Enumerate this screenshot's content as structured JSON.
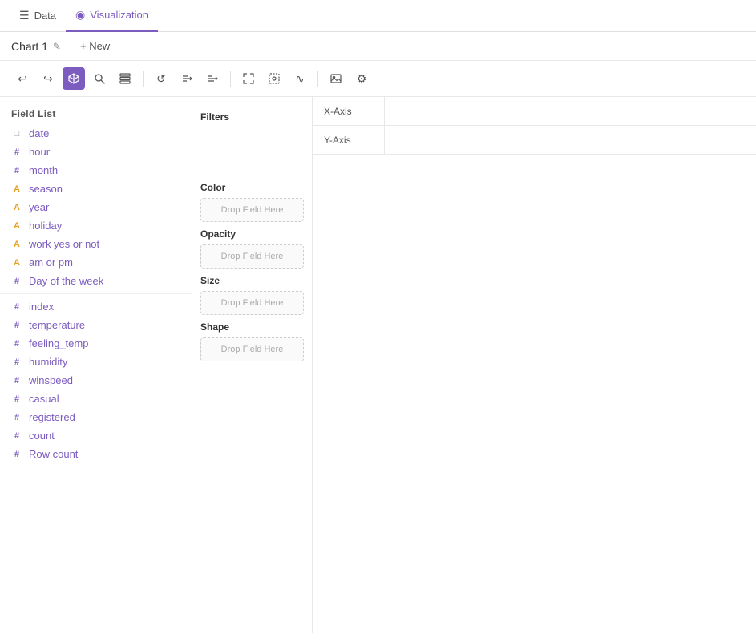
{
  "tabs": [
    {
      "id": "data",
      "label": "Data",
      "icon": "☰",
      "active": false
    },
    {
      "id": "visualization",
      "label": "Visualization",
      "icon": "◉",
      "active": true
    }
  ],
  "chart_title": "Chart 1",
  "new_button_label": "+ New",
  "toolbar": {
    "buttons": [
      {
        "id": "undo",
        "icon": "↩",
        "label": "undo",
        "active": false
      },
      {
        "id": "redo",
        "icon": "↪",
        "label": "redo",
        "active": false
      },
      {
        "id": "cube",
        "icon": "⬡",
        "label": "cube-view",
        "active": true
      },
      {
        "id": "search",
        "icon": "○",
        "label": "search",
        "active": false
      },
      {
        "id": "layers",
        "icon": "⧉",
        "label": "layers",
        "active": false
      },
      {
        "divider": true
      },
      {
        "id": "refresh",
        "icon": "↺",
        "label": "refresh",
        "active": false
      },
      {
        "id": "filter1",
        "icon": "⇅",
        "label": "filter-asc",
        "active": false
      },
      {
        "id": "filter2",
        "icon": "⇵",
        "label": "filter-desc",
        "active": false
      },
      {
        "divider": true
      },
      {
        "id": "move",
        "icon": "⤢",
        "label": "move",
        "active": false
      },
      {
        "id": "select",
        "icon": "⊡",
        "label": "select",
        "active": false
      },
      {
        "id": "connect",
        "icon": "∿",
        "label": "connect",
        "active": false
      },
      {
        "divider": true
      },
      {
        "id": "image",
        "icon": "⬜",
        "label": "image",
        "active": false
      },
      {
        "id": "settings",
        "icon": "◫",
        "label": "settings",
        "active": false
      }
    ]
  },
  "field_list": {
    "title": "Field List",
    "fields": [
      {
        "id": "date",
        "label": "date",
        "type": "date",
        "icon": "□"
      },
      {
        "id": "hour",
        "label": "hour",
        "type": "numeric",
        "icon": "#"
      },
      {
        "id": "month",
        "label": "month",
        "type": "numeric",
        "icon": "#"
      },
      {
        "id": "season",
        "label": "season",
        "type": "text",
        "icon": "A"
      },
      {
        "id": "year",
        "label": "year",
        "type": "text",
        "icon": "A"
      },
      {
        "id": "holiday",
        "label": "holiday",
        "type": "text",
        "icon": "A"
      },
      {
        "id": "work_yes_or_not",
        "label": "work yes or not",
        "type": "text",
        "icon": "A"
      },
      {
        "id": "am_or_pm",
        "label": "am or pm",
        "type": "text",
        "icon": "A"
      },
      {
        "id": "day_of_week",
        "label": "Day of the week",
        "type": "numeric",
        "icon": "#"
      },
      {
        "id": "index",
        "label": "index",
        "type": "numeric",
        "icon": "#"
      },
      {
        "id": "temperature",
        "label": "temperature",
        "type": "numeric",
        "icon": "#"
      },
      {
        "id": "feeling_temp",
        "label": "feeling_temp",
        "type": "numeric",
        "icon": "#"
      },
      {
        "id": "humidity",
        "label": "humidity",
        "type": "numeric",
        "icon": "#"
      },
      {
        "id": "winspeed",
        "label": "winspeed",
        "type": "numeric",
        "icon": "#"
      },
      {
        "id": "casual",
        "label": "casual",
        "type": "numeric",
        "icon": "#"
      },
      {
        "id": "registered",
        "label": "registered",
        "type": "numeric",
        "icon": "#"
      },
      {
        "id": "count",
        "label": "count",
        "type": "numeric",
        "icon": "#"
      },
      {
        "id": "row_count",
        "label": "Row count",
        "type": "numeric",
        "icon": "#"
      }
    ]
  },
  "config_panel": {
    "filters_label": "Filters",
    "color_label": "Color",
    "color_drop": "Drop Field Here",
    "opacity_label": "Opacity",
    "opacity_drop": "Drop Field Here",
    "size_label": "Size",
    "size_drop": "Drop Field Here",
    "shape_label": "Shape",
    "shape_drop": "Drop Field Here"
  },
  "axes": {
    "x_label": "X-Axis",
    "y_label": "Y-Axis",
    "x_placeholder": "",
    "y_placeholder": ""
  }
}
